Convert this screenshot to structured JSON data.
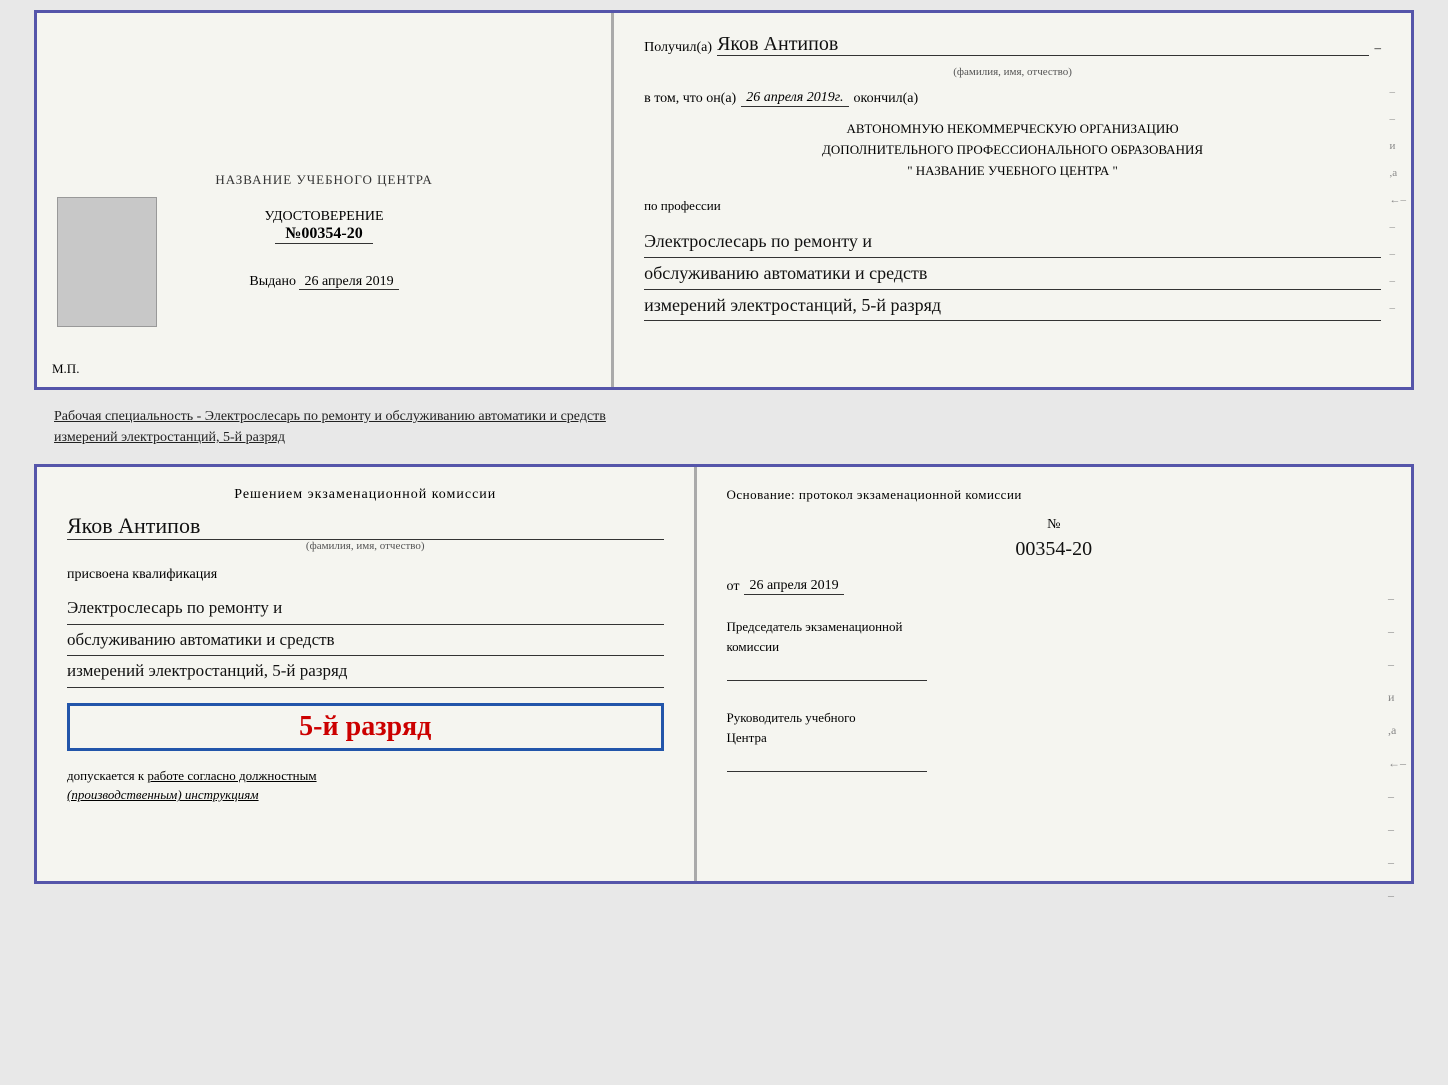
{
  "topCert": {
    "left": {
      "centerTitle": "НАЗВАНИЕ УЧЕБНОГО ЦЕНТРА",
      "certLabel": "УДОСТОВЕРЕНИЕ",
      "certNumberPrefix": "№",
      "certNumber": "00354-20",
      "issuedLabel": "Выдано",
      "issuedDate": "26 апреля 2019",
      "mpLabel": "М.П."
    },
    "right": {
      "recipientLabel": "Получил(а)",
      "recipientName": "Яков Антипов",
      "fioHint": "(фамилия, имя, отчество)",
      "attestationPrefix": "в том, что он(а)",
      "attestationDate": "26 апреля 2019г.",
      "attestationSuffix": "окончил(а)",
      "orgLine1": "АВТОНОМНУЮ НЕКОММЕРЧЕСКУЮ ОРГАНИЗАЦИЮ",
      "orgLine2": "ДОПОЛНИТЕЛЬНОГО ПРОФЕССИОНАЛЬНОГО ОБРАЗОВАНИЯ",
      "orgLine3": "\"   НАЗВАНИЕ УЧЕБНОГО ЦЕНТРА   \"",
      "professionLabel": "по профессии",
      "professionLine1": "Электрослесарь по ремонту и",
      "professionLine2": "обслуживанию автоматики и средств",
      "professionLine3": "измерений электростанций, 5-й разряд"
    }
  },
  "middleText": "Рабочая специальность - Электрослесарь по ремонту и обслуживанию автоматики и средств\nизмерений электростанций, 5-й разряд",
  "bottomCert": {
    "left": {
      "decisionTitle": "Решением экзаменационной комиссии",
      "nameHandwritten": "Яков Антипов",
      "fioHint": "(фамилия, имя, отчество)",
      "qualificationLabel": "присвоена квалификация",
      "qualLine1": "Электрослесарь по ремонту и",
      "qualLine2": "обслуживанию автоматики и средств",
      "qualLine3": "измерений электростанций, 5-й разряд",
      "rankText": "5-й разряд",
      "allowedPrefix": "допускается к",
      "allowedUnderline": "работе согласно должностным",
      "allowedItalic": "(производственным) инструкциям"
    },
    "right": {
      "basisLabel": "Основание: протокол экзаменационной комиссии",
      "numberPrefix": "№",
      "protocolNumber": "00354-20",
      "fromPrefix": "от",
      "fromDate": "26 апреля 2019",
      "chairmanLine1": "Председатель экзаменационной",
      "chairmanLine2": "комиссии",
      "directorLine1": "Руководитель учебного",
      "directorLine2": "Центра"
    }
  },
  "sideMark": "ИТо"
}
